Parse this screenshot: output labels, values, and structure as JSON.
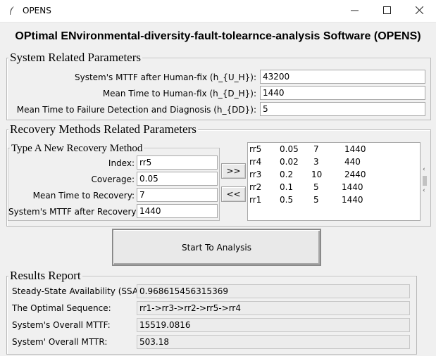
{
  "window": {
    "title": "OPENS",
    "icon": "feather-icon"
  },
  "header": "OPtimal ENvironmental-diversity-fault-tolearnce-analysis Software (OPENS)",
  "system_params": {
    "legend": "System Related Parameters",
    "fields": [
      {
        "label": "System's MTTF after Human-fix (h_{U_H}):",
        "value": "43200"
      },
      {
        "label": "Mean Time to Human-fix (h_{D_H}):",
        "value": "1440"
      },
      {
        "label": "Mean Time to Failure Detection and Diagnosis (h_{DD}):",
        "value": "5"
      }
    ]
  },
  "recovery_params": {
    "legend": "Recovery Methods Related Parameters",
    "new_method": {
      "legend": "Type A New Recovery Method",
      "fields": [
        {
          "label": "Index:",
          "value": "rr5"
        },
        {
          "label": "Coverage:",
          "value": "0.05"
        },
        {
          "label": "Mean Time to Recovery:",
          "value": "7"
        },
        {
          "label": "System's MTTF after Recovery:",
          "value": "1440"
        }
      ]
    },
    "add_button": ">>",
    "remove_button": "<<",
    "list": [
      {
        "index": "rr5",
        "coverage": "0.05",
        "mttr": "7",
        "mttf": "1440"
      },
      {
        "index": "rr4",
        "coverage": "0.02",
        "mttr": "3",
        "mttf": "440"
      },
      {
        "index": "rr3",
        "coverage": "0.2",
        "mttr": "10",
        "mttf": "2440"
      },
      {
        "index": "rr2",
        "coverage": "0.1",
        "mttr": "5",
        "mttf": "1440"
      },
      {
        "index": "rr1",
        "coverage": "0.5",
        "mttr": "5",
        "mttf": "1440"
      }
    ]
  },
  "start_button": "Start To Analysis",
  "results": {
    "legend": "Results Report",
    "rows": [
      {
        "label": "Steady-State Availability (SSA):",
        "value": "0.968615456315369"
      },
      {
        "label": "The Optimal Sequence:",
        "value": "rr1->rr3->rr2->rr5->rr4"
      },
      {
        "label": "System's Overall MTTF:",
        "value": "15519.0816"
      },
      {
        "label": "System' Overall MTTR:",
        "value": "503.18"
      }
    ]
  }
}
